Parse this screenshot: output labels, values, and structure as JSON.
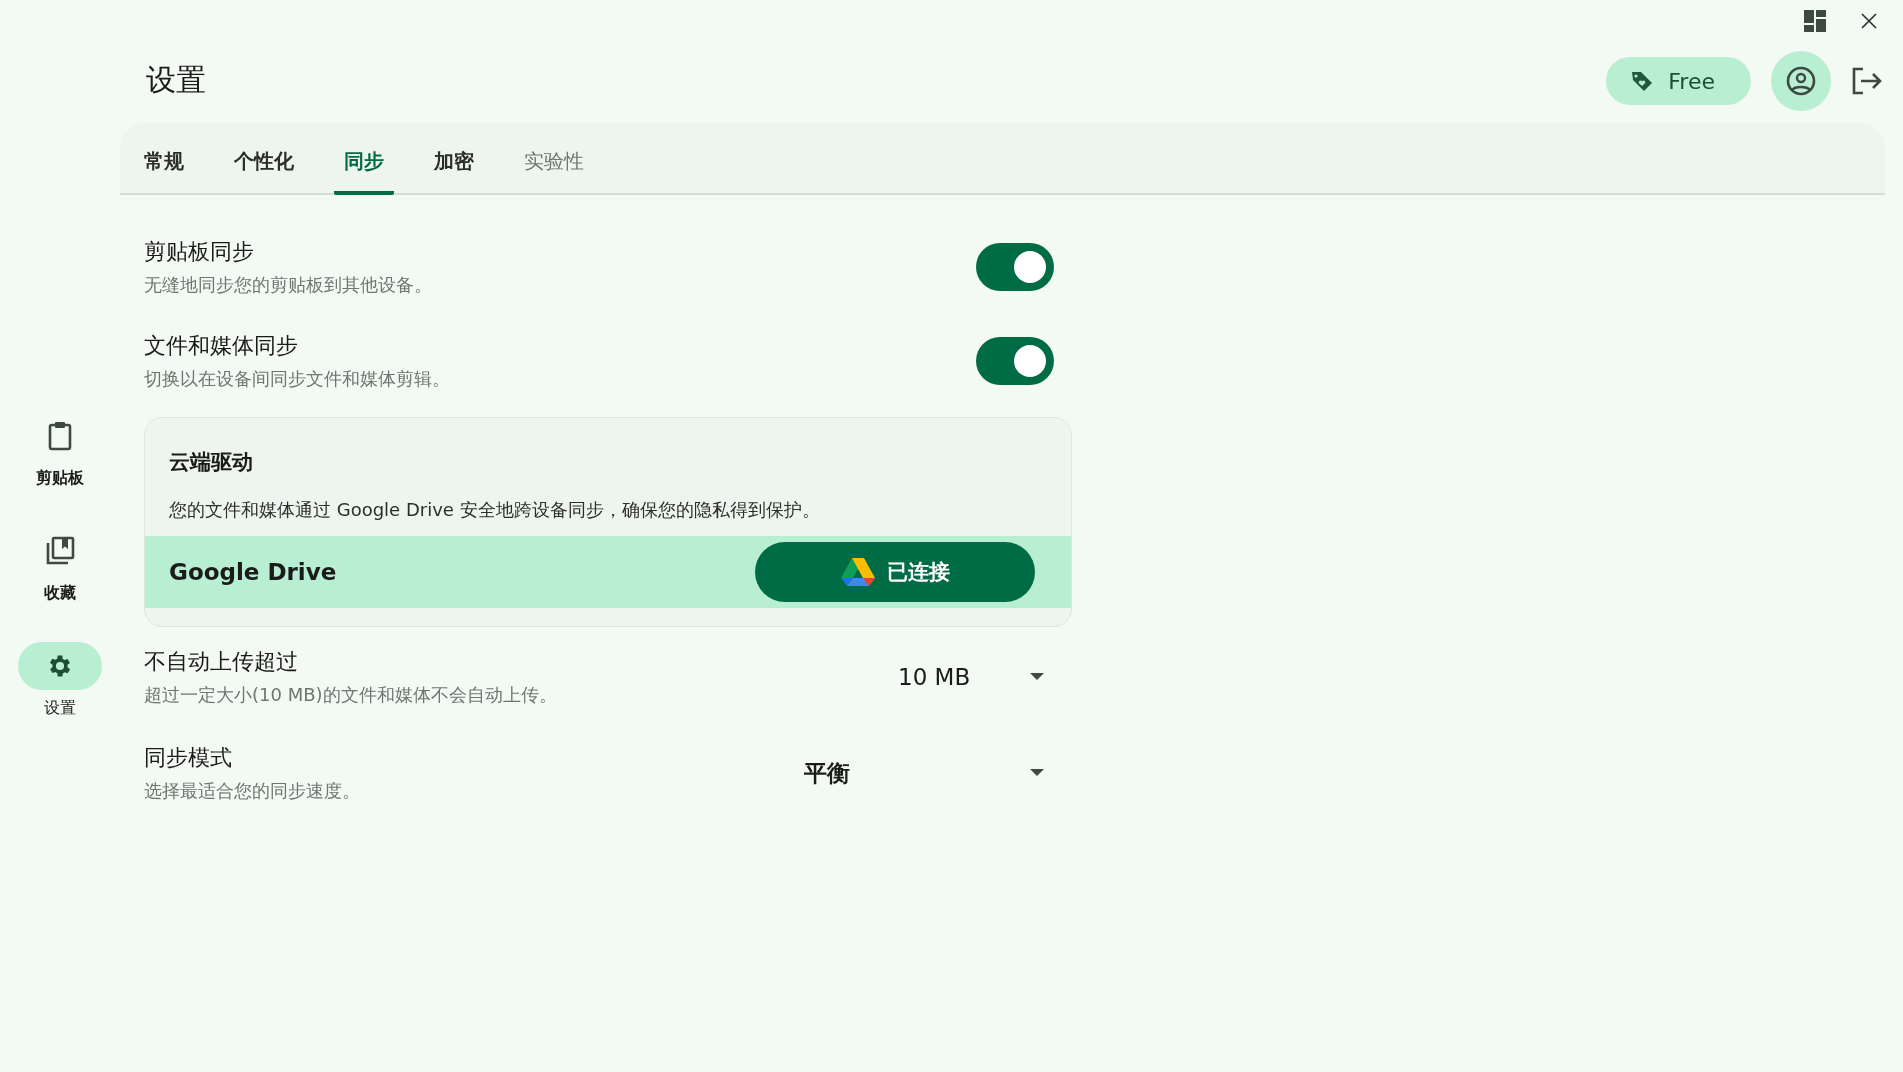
{
  "sidebar": {
    "items": [
      {
        "kind": "clipboard",
        "label": "剪贴板",
        "selected": false
      },
      {
        "kind": "library",
        "label": "收藏",
        "selected": false
      },
      {
        "kind": "settings",
        "label": "设置",
        "selected": true
      }
    ]
  },
  "header": {
    "title": "设置",
    "plan_button": "Free"
  },
  "tabs": [
    {
      "label": "常规",
      "selected": false,
      "disabled": false
    },
    {
      "label": "个性化",
      "selected": false,
      "disabled": false
    },
    {
      "label": "同步",
      "selected": true,
      "disabled": false
    },
    {
      "label": "加密",
      "selected": false,
      "disabled": false
    },
    {
      "label": "实验性",
      "selected": false,
      "disabled": true
    }
  ],
  "settings": [
    {
      "kind": "toggle",
      "title": "剪贴板同步",
      "description": "无缝地同步您的剪贴板到其他设备。",
      "on": true
    },
    {
      "kind": "toggle",
      "title": "文件和媒体同步",
      "description": "切换以在设备间同步文件和媒体剪辑。",
      "on": true
    },
    {
      "kind": "card",
      "title": "云端驱动",
      "description": "您的文件和媒体通过 Google Drive 安全地跨设备同步，确保您的隐私得到保护。",
      "provider": "Google Drive",
      "button": "已连接"
    },
    {
      "kind": "dropdown",
      "title": "不自动上传超过",
      "description": "超过一定大小(10 MB)的文件和媒体不会自动上传。",
      "value": "10 MB",
      "bold": false
    },
    {
      "kind": "dropdown",
      "title": "同步模式",
      "description": "选择最适合您的同步速度。",
      "value": "平衡",
      "bold": true
    }
  ]
}
